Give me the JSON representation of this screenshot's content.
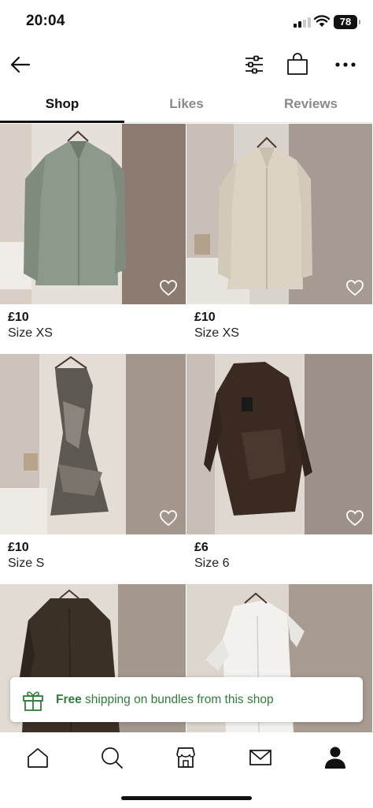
{
  "status_bar": {
    "time": "20:04",
    "battery": "78"
  },
  "top_bar": {
    "icons": [
      "back-arrow-icon",
      "filter-sliders-icon",
      "shopping-bag-icon",
      "more-dots-icon"
    ]
  },
  "tabs": [
    {
      "label": "Shop",
      "active": true
    },
    {
      "label": "Likes",
      "active": false
    },
    {
      "label": "Reviews",
      "active": false
    }
  ],
  "products": [
    {
      "price": "£10",
      "size": "Size XS",
      "item": "sage green satin shirt",
      "color": "#8d9a8b"
    },
    {
      "price": "£10",
      "size": "Size XS",
      "item": "cream satin shirt",
      "color": "#ddd3c4"
    },
    {
      "price": "£10",
      "size": "Size S",
      "item": "printed halter mini dress",
      "color": "#5d5852"
    },
    {
      "price": "£6",
      "size": "Size 6",
      "item": "brown satin ruched dress",
      "color": "#3b2a22"
    },
    {
      "price": "",
      "size": "",
      "item": "brown utility jacket",
      "color": "#3a3026"
    },
    {
      "price": "",
      "size": "",
      "item": "white shirt dress",
      "color": "#f2f1ee"
    }
  ],
  "banner": {
    "bold": "Free",
    "text": " shipping on bundles from this shop",
    "accent_color": "#2f7d3a"
  },
  "bottom_nav": {
    "items": [
      "home-icon",
      "search-icon",
      "shop-icon",
      "inbox-icon",
      "profile-icon"
    ],
    "active": "profile-icon"
  }
}
